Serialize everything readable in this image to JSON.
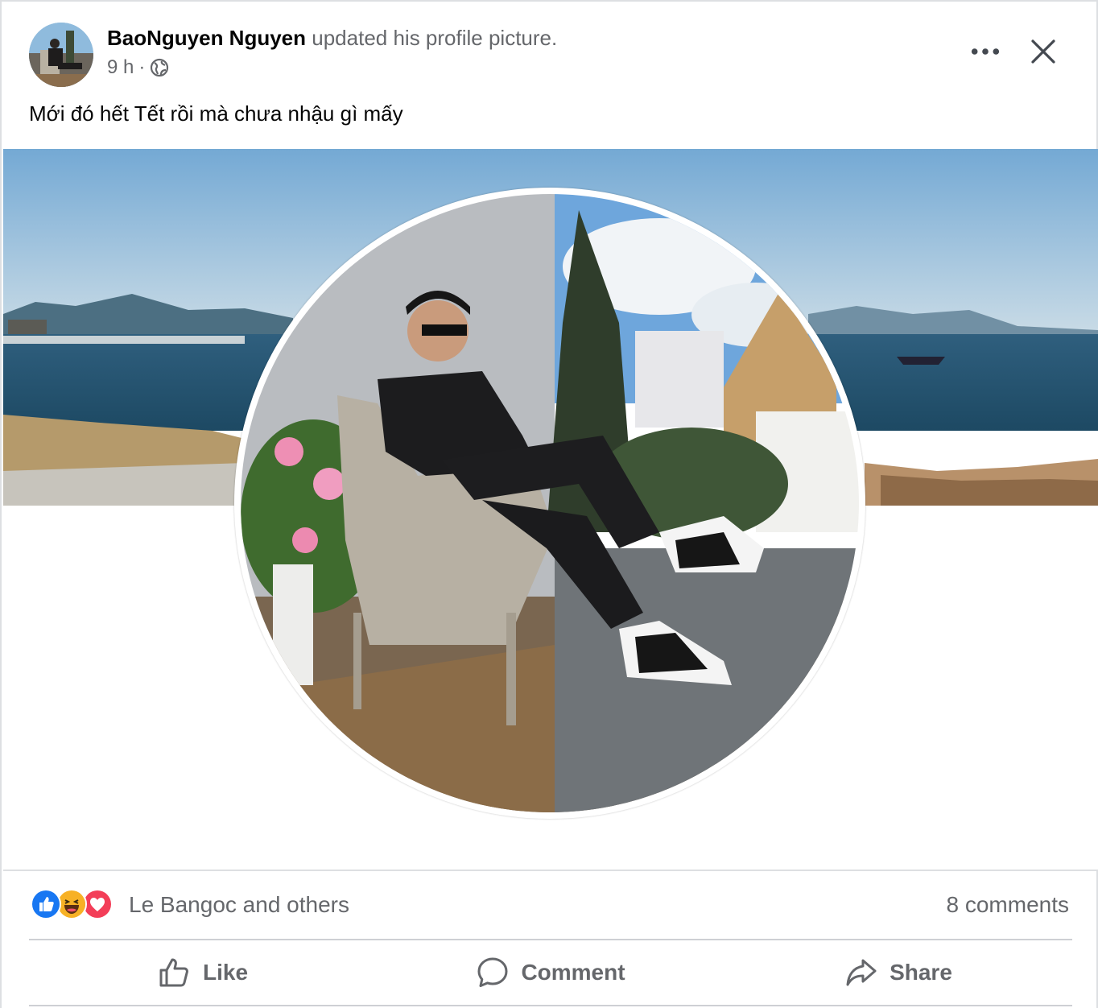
{
  "post": {
    "author_name": "BaoNguyen Nguyen",
    "action_text": "updated his profile picture.",
    "time": "9 h",
    "separator": "·",
    "privacy_icon": "globe-icon",
    "caption": "Mới đó hết Tết rồi mà chưa nhậu gì mấy"
  },
  "header": {
    "more_icon": "more-dots-icon",
    "close_icon": "close-icon"
  },
  "reactions": {
    "icons": [
      "like-reaction-icon",
      "haha-reaction-icon",
      "love-reaction-icon"
    ],
    "text": "Le Bangoc and others",
    "comments_count": "8 comments"
  },
  "actions": [
    {
      "label": "Like",
      "icon": "thumbs-up-icon"
    },
    {
      "label": "Comment",
      "icon": "comment-bubble-icon"
    },
    {
      "label": "Share",
      "icon": "share-arrow-icon"
    }
  ],
  "colors": {
    "text_primary": "#050505",
    "text_secondary": "#65676b",
    "divider": "#ced0d4",
    "like_blue": "#1877f2",
    "love_red": "#f33e58",
    "haha_yellow": "#f7b125"
  }
}
